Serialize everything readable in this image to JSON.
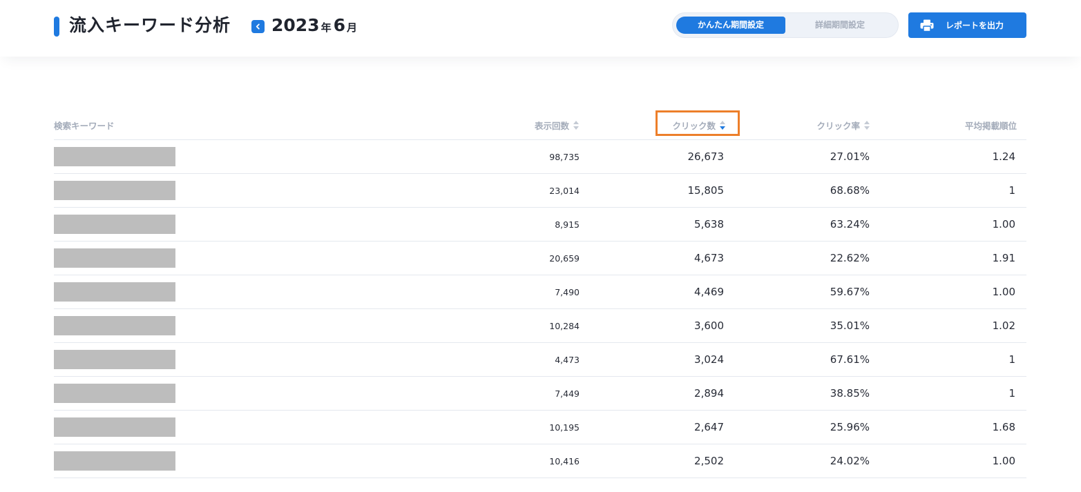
{
  "header": {
    "title": "流入キーワード分析",
    "period_year": "2023",
    "period_year_unit": "年",
    "period_month": "6",
    "period_month_unit": "月",
    "segment": {
      "active_label": "かんたん期間設定",
      "inactive_label": "詳細期間設定"
    },
    "report_button_label": "レポートを出力",
    "accent_color": "#1f7ae0"
  },
  "table": {
    "columns": {
      "keyword": "検索キーワード",
      "impressions": "表示回数",
      "clicks": "クリック数",
      "ctr": "クリック率",
      "avg_position": "平均掲載順位"
    },
    "sorted_by": "clicks",
    "sort_direction": "desc",
    "rows": [
      {
        "impressions": "98,735",
        "clicks": "26,673",
        "ctr": "27.01%",
        "avg_position": "1.24"
      },
      {
        "impressions": "23,014",
        "clicks": "15,805",
        "ctr": "68.68%",
        "avg_position": "1"
      },
      {
        "impressions": "8,915",
        "clicks": "5,638",
        "ctr": "63.24%",
        "avg_position": "1.00"
      },
      {
        "impressions": "20,659",
        "clicks": "4,673",
        "ctr": "22.62%",
        "avg_position": "1.91"
      },
      {
        "impressions": "7,490",
        "clicks": "4,469",
        "ctr": "59.67%",
        "avg_position": "1.00"
      },
      {
        "impressions": "10,284",
        "clicks": "3,600",
        "ctr": "35.01%",
        "avg_position": "1.02"
      },
      {
        "impressions": "4,473",
        "clicks": "3,024",
        "ctr": "67.61%",
        "avg_position": "1"
      },
      {
        "impressions": "7,449",
        "clicks": "2,894",
        "ctr": "38.85%",
        "avg_position": "1"
      },
      {
        "impressions": "10,195",
        "clicks": "2,647",
        "ctr": "25.96%",
        "avg_position": "1.68"
      },
      {
        "impressions": "10,416",
        "clicks": "2,502",
        "ctr": "24.02%",
        "avg_position": "1.00"
      }
    ]
  }
}
